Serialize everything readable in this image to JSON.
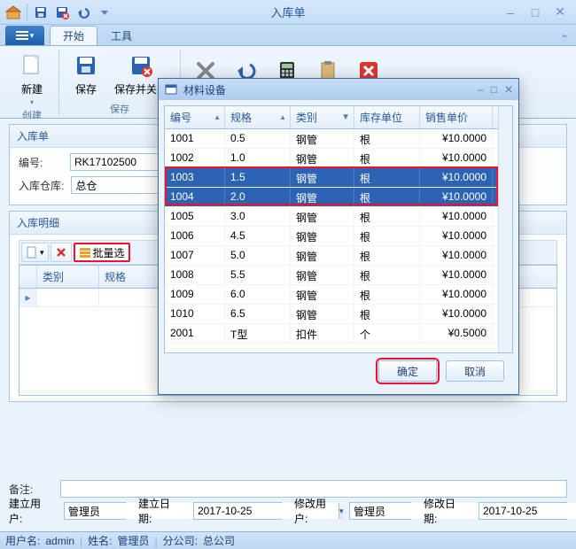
{
  "window": {
    "title": "入库单"
  },
  "ribbon": {
    "tabs": {
      "start": "开始",
      "tools": "工具"
    },
    "groups": {
      "create": {
        "label": "创建",
        "new": "新建"
      },
      "save": {
        "label": "保存",
        "save": "保存",
        "save_close": "保存并关闭"
      }
    }
  },
  "form": {
    "header": "入库单",
    "fields": {
      "code_label": "编号:",
      "code_value": "RK17102500",
      "warehouse_label": "入库仓库:",
      "warehouse_value": "总仓"
    },
    "detail_header": "入库明细",
    "detail_toolbar": {
      "batch_select": "批量选"
    },
    "detail_grid": {
      "cols": [
        "类别",
        "规格"
      ]
    },
    "note_label": "备注:",
    "note_value": "",
    "audit": {
      "created_by_label": "建立用户:",
      "created_by": "管理员",
      "created_at_label": "建立日期:",
      "created_at": "2017-10-25",
      "modified_by_label": "修改用户:",
      "modified_by": "管理员",
      "modified_at_label": "修改日期:",
      "modified_at": "2017-10-25"
    }
  },
  "dialog": {
    "title": "材料设备",
    "cols": [
      "编号",
      "规格",
      "类别",
      "库存单位",
      "销售单价"
    ],
    "rows": [
      {
        "id": "1001",
        "spec": "0.5",
        "cat": "钢管",
        "unit": "根",
        "price": "¥10.0000"
      },
      {
        "id": "1002",
        "spec": "1.0",
        "cat": "钢管",
        "unit": "根",
        "price": "¥10.0000"
      },
      {
        "id": "1003",
        "spec": "1.5",
        "cat": "钢管",
        "unit": "根",
        "price": "¥10.0000"
      },
      {
        "id": "1004",
        "spec": "2.0",
        "cat": "钢管",
        "unit": "根",
        "price": "¥10.0000"
      },
      {
        "id": "1005",
        "spec": "3.0",
        "cat": "钢管",
        "unit": "根",
        "price": "¥10.0000"
      },
      {
        "id": "1006",
        "spec": "4.5",
        "cat": "钢管",
        "unit": "根",
        "price": "¥10.0000"
      },
      {
        "id": "1007",
        "spec": "5.0",
        "cat": "钢管",
        "unit": "根",
        "price": "¥10.0000"
      },
      {
        "id": "1008",
        "spec": "5.5",
        "cat": "钢管",
        "unit": "根",
        "price": "¥10.0000"
      },
      {
        "id": "1009",
        "spec": "6.0",
        "cat": "钢管",
        "unit": "根",
        "price": "¥10.0000"
      },
      {
        "id": "1010",
        "spec": "6.5",
        "cat": "钢管",
        "unit": "根",
        "price": "¥10.0000"
      },
      {
        "id": "2001",
        "spec": "T型",
        "cat": "扣件",
        "unit": "个",
        "price": "¥0.5000"
      }
    ],
    "selected": [
      2,
      3
    ],
    "ok": "确定",
    "cancel": "取消"
  },
  "status": {
    "user_label": "用户名:",
    "user": "admin",
    "name_label": "姓名:",
    "name": "管理员",
    "branch_label": "分公司:",
    "branch": "总公司"
  }
}
